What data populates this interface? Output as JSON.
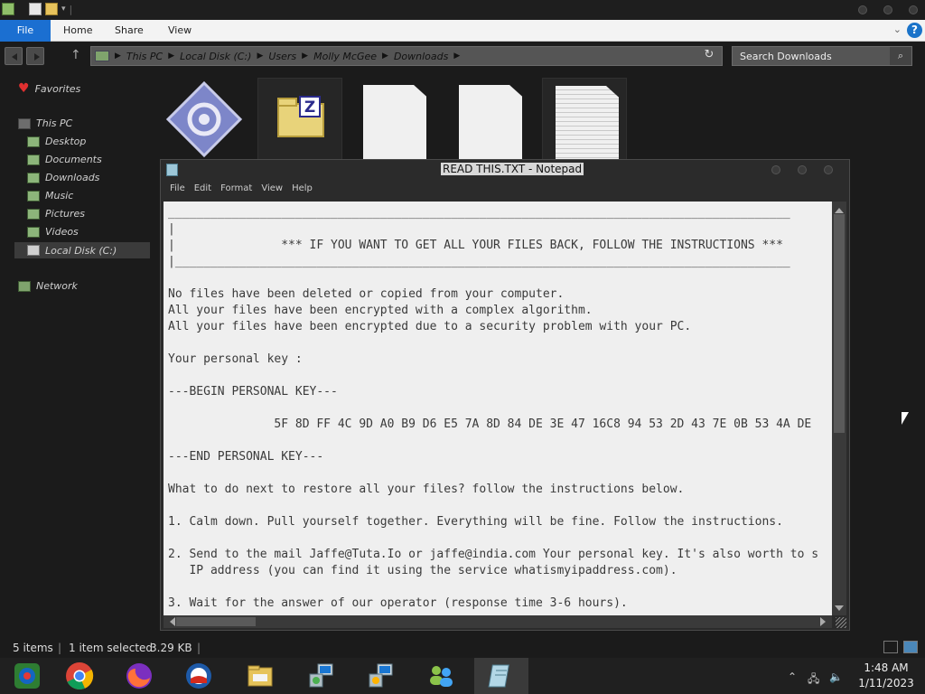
{
  "explorer": {
    "ribbon_tabs": [
      "File",
      "Home",
      "Share",
      "View"
    ],
    "help_glyph": "?",
    "address_crumbs": [
      "This PC",
      "Local Disk (C:)",
      "Users",
      "Molly McGee",
      "Downloads"
    ],
    "search_placeholder": "Search Downloads",
    "sidebar": {
      "favorites": "Favorites",
      "this_pc": "This PC",
      "items": [
        "Desktop",
        "Documents",
        "Downloads",
        "Music",
        "Pictures",
        "Videos",
        "Local Disk (C:)"
      ],
      "network": "Network",
      "selected": "Local Disk (C:)"
    },
    "file_icons": [
      "application-icon",
      "zip-folder-icon",
      "blank-file-icon",
      "blank-file-icon",
      "text-document-icon"
    ],
    "status": {
      "items": "5 items",
      "selected": "1 item selected",
      "size": "3.29 KB"
    }
  },
  "notepad": {
    "title": "READ THIS.TXT - Notepad",
    "menu": [
      "File",
      "Edit",
      "Format",
      "View",
      "Help"
    ],
    "lines": [
      "________________________________________________________________________________________",
      "|",
      "|               *** IF YOU WANT TO GET ALL YOUR FILES BACK, FOLLOW THE INSTRUCTIONS ***",
      "|_______________________________________________________________________________________",
      "",
      "No files have been deleted or copied from your computer.",
      "All your files have been encrypted with a complex algorithm.",
      "All your files have been encrypted due to a security problem with your PC.",
      "",
      "Your personal key :",
      "",
      "---BEGIN PERSONAL KEY---",
      "",
      "               5F 8D FF 4C 9D A0 B9 D6 E5 7A 8D 84 DE 3E 47 16C8 94 53 2D 43 7E 0B 53 4A DE",
      "",
      "---END PERSONAL KEY---",
      "",
      "What to do next to restore all your files? follow the instructions below.",
      "",
      "1. Calm down. Pull yourself together. Everything will be fine. Follow the instructions.",
      "",
      "2. Send to the mail Jaffe@Tuta.Io or jaffe@india.com Your personal key. It's also worth to s",
      "   IP address (you can find it using the service whatismyipaddress.com).",
      "",
      "3. Wait for the answer of our operator (response time 3-6 hours)."
    ]
  },
  "taskbar": {
    "apps": [
      "windows-store-icon",
      "chrome-icon",
      "firefox-icon",
      "obama-icon",
      "file-explorer-icon",
      "network-setup-icon",
      "network-setup-icon-2",
      "users-icon",
      "notepad-icon"
    ],
    "clock_time": "1:48 AM",
    "clock_date": "1/11/2023"
  },
  "colors": {
    "ribbon_file": "#1b6fd1",
    "background": "#1b1b1b",
    "notepad_text": "#3a3a3a"
  }
}
